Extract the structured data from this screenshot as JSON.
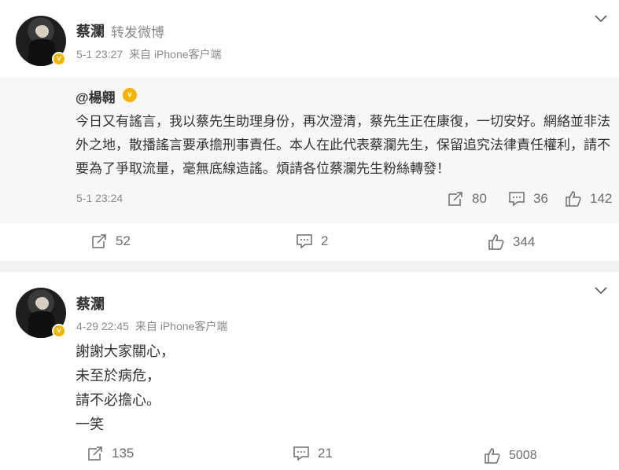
{
  "post1": {
    "author": "蔡瀾",
    "repost_tag": "转发微博",
    "time": "5-1 23:27",
    "source": "来自 iPhone客户端",
    "quoted": {
      "author": "@楊翱",
      "text": "今日又有謠言，我以蔡先生助理身份，再次澄清，蔡先生正在康復，一切安好。網絡並非法外之地，散播謠言要承擔刑事責任。本人在此代表蔡瀾先生，保留追究法律責任權利，請不要為了爭取流量，毫無底線造謠。煩請各位蔡瀾先生粉絲轉發！",
      "time": "5-1 23:24",
      "reposts": "80",
      "comments": "36",
      "likes": "142"
    },
    "reposts": "52",
    "comments": "2",
    "likes": "344"
  },
  "post2": {
    "author": "蔡瀾",
    "time": "4-29 22:45",
    "source": "来自 iPhone客户端",
    "lines": [
      "謝謝大家關心，",
      "未至於病危，",
      "請不必擔心。",
      "一笑"
    ],
    "reposts": "135",
    "comments": "21",
    "likes": "5008"
  },
  "icons": {
    "verified": "verified-badge-icon",
    "more": "chevron-down-icon",
    "repost": "repost-icon",
    "comment": "comment-icon",
    "like": "thumbs-up-icon"
  },
  "colors": {
    "verified": "#f5b400",
    "muted_text": "#8a8a8a",
    "quoted_bg": "#f7f7f7"
  }
}
